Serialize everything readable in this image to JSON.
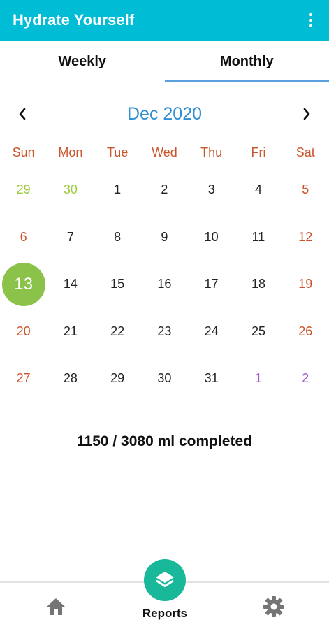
{
  "app": {
    "title": "Hydrate Yourself"
  },
  "tabs": [
    {
      "label": "Weekly",
      "active": false
    },
    {
      "label": "Monthly",
      "active": true
    }
  ],
  "calendar": {
    "month_label": "Dec 2020",
    "weekdays": [
      "Sun",
      "Mon",
      "Tue",
      "Wed",
      "Thu",
      "Fri",
      "Sat"
    ],
    "weeks": [
      [
        "29",
        "30",
        "1",
        "2",
        "3",
        "4",
        "5"
      ],
      [
        "6",
        "7",
        "8",
        "9",
        "10",
        "11",
        "12"
      ],
      [
        "13",
        "14",
        "15",
        "16",
        "17",
        "18",
        "19"
      ],
      [
        "20",
        "21",
        "22",
        "23",
        "24",
        "25",
        "26"
      ],
      [
        "27",
        "28",
        "29",
        "30",
        "31",
        "1",
        "2"
      ]
    ],
    "selected_day": "13"
  },
  "summary": {
    "progress_text": "1150 / 3080 ml completed"
  },
  "bottom_nav": {
    "reports_label": "Reports"
  },
  "colors": {
    "appbar": "#00bcd4",
    "tab_indicator": "#5aa0e0",
    "month_title": "#2f8fd0",
    "weekend": "#c9552b",
    "prev_month_days": "#9acb3e",
    "next_month_days": "#a45ad2",
    "selected_day": "#8bc34a",
    "fab": "#1ab89a"
  },
  "icons": {
    "overflow": "more-vert-icon",
    "prev": "chevron-left-icon",
    "next": "chevron-right-icon",
    "home": "home-icon",
    "reports": "layers-icon",
    "settings": "gear-icon"
  }
}
